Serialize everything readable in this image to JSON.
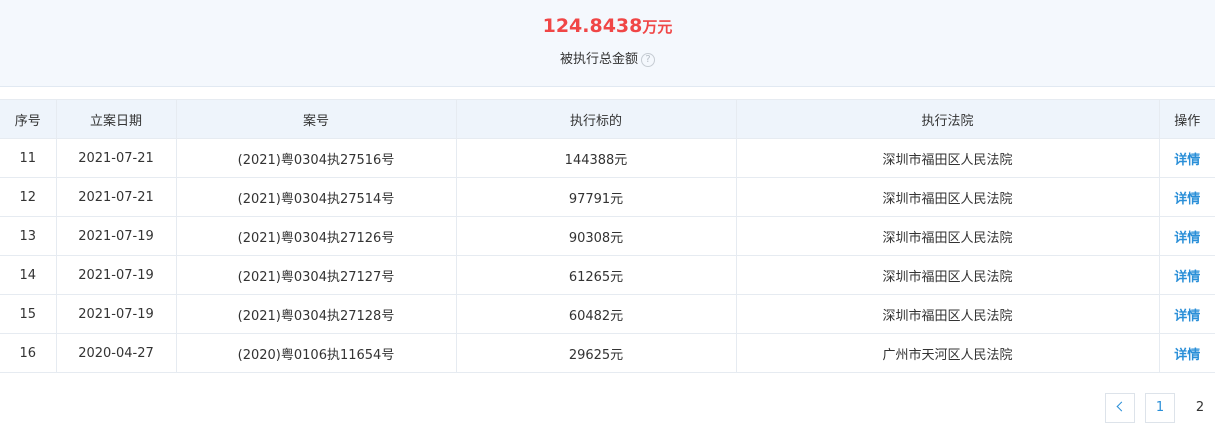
{
  "summary": {
    "amount": "124.8438",
    "unit": "万元",
    "label": "被执行总金额",
    "help": "?"
  },
  "table": {
    "headers": [
      "序号",
      "立案日期",
      "案号",
      "执行标的",
      "执行法院",
      "操作"
    ],
    "rows": [
      {
        "no": "11",
        "date": "2021-07-21",
        "case": "(2021)粤0304执27516号",
        "target": "144388元",
        "court": "深圳市福田区人民法院",
        "op": "详情"
      },
      {
        "no": "12",
        "date": "2021-07-21",
        "case": "(2021)粤0304执27514号",
        "target": "97791元",
        "court": "深圳市福田区人民法院",
        "op": "详情"
      },
      {
        "no": "13",
        "date": "2021-07-19",
        "case": "(2021)粤0304执27126号",
        "target": "90308元",
        "court": "深圳市福田区人民法院",
        "op": "详情"
      },
      {
        "no": "14",
        "date": "2021-07-19",
        "case": "(2021)粤0304执27127号",
        "target": "61265元",
        "court": "深圳市福田区人民法院",
        "op": "详情"
      },
      {
        "no": "15",
        "date": "2021-07-19",
        "case": "(2021)粤0304执27128号",
        "target": "60482元",
        "court": "深圳市福田区人民法院",
        "op": "详情"
      },
      {
        "no": "16",
        "date": "2020-04-27",
        "case": "(2020)粤0106执11654号",
        "target": "29625元",
        "court": "广州市天河区人民法院",
        "op": "详情"
      }
    ]
  },
  "pagination": {
    "pages": [
      "1",
      "2"
    ],
    "current": "2"
  },
  "colors": {
    "amount": "#f04646",
    "link": "#2a8fd8",
    "summary_bg": "#f4f8fd",
    "header_bg": "#eef4fb"
  }
}
